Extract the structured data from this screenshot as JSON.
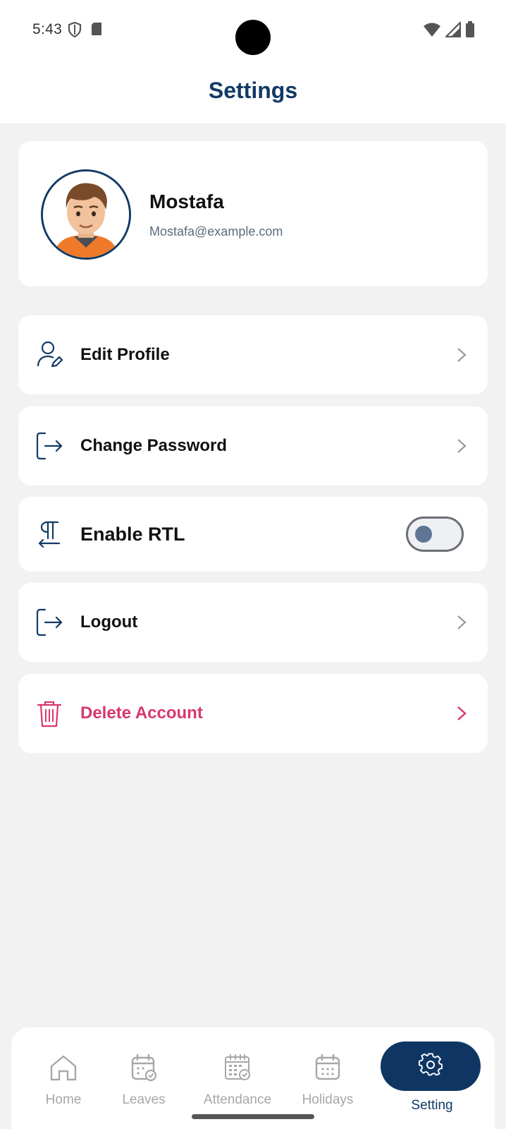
{
  "status_bar": {
    "time": "5:43",
    "left_icons": [
      "shield-icon",
      "sd-card-icon"
    ],
    "right_icons": [
      "wifi-icon",
      "signal-icon",
      "battery-icon"
    ]
  },
  "header": {
    "title": "Settings"
  },
  "profile": {
    "name": "Mostafa",
    "email": "Mostafa@example.com",
    "avatar": "cartoon-man-avatar"
  },
  "menu": {
    "edit_profile": {
      "label": "Edit Profile",
      "icon": "user-edit-icon"
    },
    "change_password": {
      "label": "Change Password",
      "icon": "login-arrow-icon"
    },
    "enable_rtl": {
      "label": "Enable RTL",
      "icon": "pilcrow-rtl-icon",
      "enabled": false
    },
    "logout": {
      "label": "Logout",
      "icon": "logout-icon"
    },
    "delete_account": {
      "label": "Delete Account",
      "icon": "trash-icon"
    }
  },
  "bottom_nav": {
    "items": [
      {
        "label": "Home",
        "icon": "home-icon"
      },
      {
        "label": "Leaves",
        "icon": "calendar-check-icon"
      },
      {
        "label": "Attendance",
        "icon": "calendar-grid-icon"
      },
      {
        "label": "Holidays",
        "icon": "calendar-icon"
      },
      {
        "label": "Setting",
        "icon": "gear-icon",
        "active": true
      }
    ]
  },
  "colors": {
    "primary": "#123a66",
    "danger": "#d8386a",
    "background": "#f2f2f2",
    "inactive": "#a7a7a7"
  }
}
